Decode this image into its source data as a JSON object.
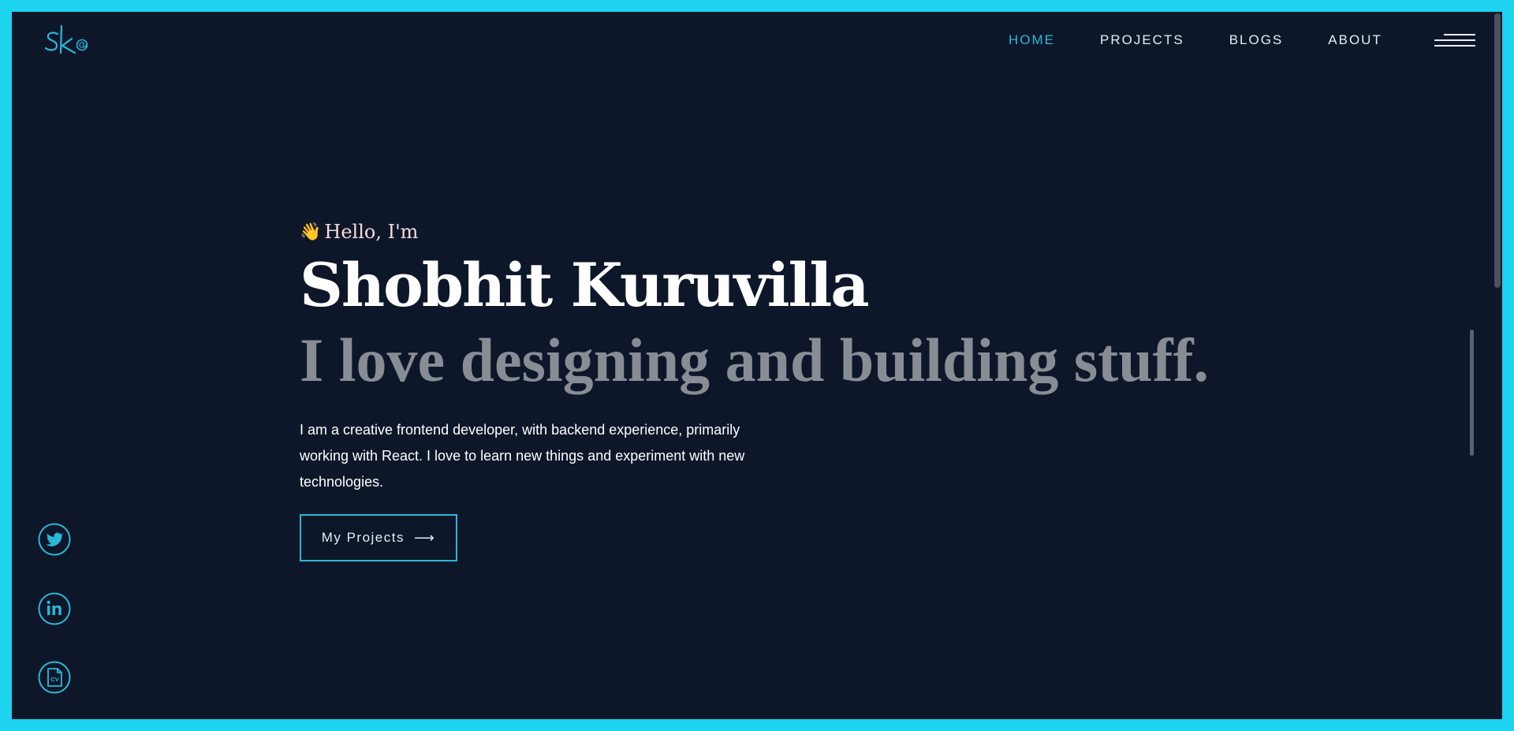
{
  "header": {
    "logo_text": "sk",
    "nav": [
      {
        "label": "HOME",
        "active": true
      },
      {
        "label": "PROJECTS",
        "active": false
      },
      {
        "label": "BLOGS",
        "active": false
      },
      {
        "label": "ABOUT",
        "active": false
      }
    ],
    "menu_icon": "hamburger-menu-icon"
  },
  "hero": {
    "greeting_emoji": "👋",
    "greeting": "Hello, I'm",
    "name": "Shobhit Kuruvilla",
    "tagline": "I love designing and building stuff.",
    "bio": "I am a creative frontend developer, with backend experience, primarily working with React. I love to learn new things and experiment with new technologies.",
    "cta_label": "My Projects",
    "cta_arrow": "⟶"
  },
  "social": [
    {
      "name": "twitter-icon"
    },
    {
      "name": "linkedin-icon"
    },
    {
      "name": "cv-icon",
      "text": "CV"
    }
  ],
  "colors": {
    "frame": "#1dd3f0",
    "background": "#0e172a",
    "accent": "#2ab8d6",
    "name": "#ffffff",
    "tagline": "#888c95",
    "greeting": "#f6dcdc"
  }
}
